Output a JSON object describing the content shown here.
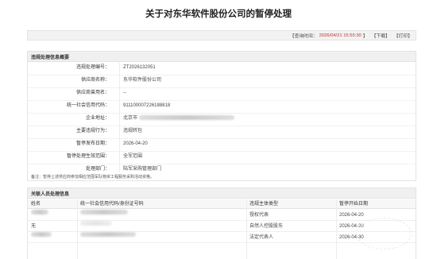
{
  "title": "关于对东华软件股份公司的暂停处理",
  "toolbar": {
    "query_label": "【查询时间：",
    "query_time": "2026/04/21 15:55:30",
    "query_close": "】",
    "download": "【下载】",
    "print": "【打印】"
  },
  "violation": {
    "header": "违规处理信息概要",
    "fields": [
      {
        "label": "违规处理编号：",
        "value": "ZT2026132051"
      },
      {
        "label": "供应商名称：",
        "value": "东华软件股份公司"
      },
      {
        "label": "供应商曾用名：",
        "value": "--"
      },
      {
        "label": "统一社会信用代码：",
        "value": "911100007226188818"
      },
      {
        "label": "企业地址：",
        "value": "北京市"
      },
      {
        "label": "主要违规行为：",
        "value": "违规转包"
      },
      {
        "label": "暂停发布日期：",
        "value": "2026-04-20"
      },
      {
        "label": "暂停处理生效范围：",
        "value": "全军范围"
      },
      {
        "label": "处理部门：",
        "value": "陆军采购管理部门"
      }
    ],
    "note": "备注：暂停上述供应商参加相应范围军队物资工程服务采购活动资格。"
  },
  "persons": {
    "header": "关联人员处理信息",
    "columns": [
      "姓名",
      "统一社会信用代码/身份证号码",
      "违规主体类型",
      "暂停开始日期"
    ],
    "rows": [
      {
        "name": "",
        "id": "",
        "type": "授权代表",
        "date": "2026-04-20"
      },
      {
        "name": "无",
        "id": "",
        "type": "自然人控股股东",
        "date": "2026-04-20"
      },
      {
        "name": "",
        "id": "",
        "type": "法定代表人",
        "date": "2026-04-30"
      }
    ]
  }
}
